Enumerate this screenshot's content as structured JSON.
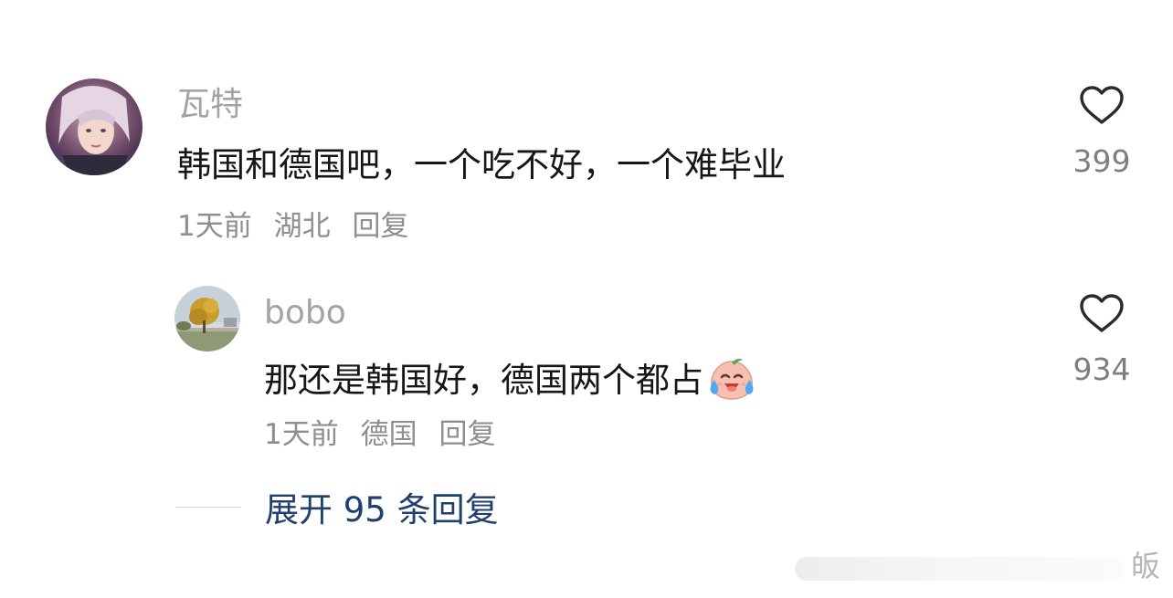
{
  "comments": [
    {
      "username": "瓦特",
      "content": "韩国和德国吧，一个吃不好，一个难毕业",
      "time": "1天前",
      "location": "湖北",
      "reply_label": "回复",
      "like_count": "399"
    },
    {
      "username": "bobo",
      "content": "那还是韩国好，德国两个都占",
      "emoji": "crying-laughing-peach-emoji",
      "time": "1天前",
      "location": "德国",
      "reply_label": "回复",
      "like_count": "934"
    }
  ],
  "expand_replies": {
    "label": "展开 95 条回复"
  },
  "watermark": {
    "text": "皈"
  },
  "colors": {
    "username": "#a3a3a3",
    "content": "#161616",
    "meta": "#8e8e8e",
    "expand_link": "#1f3f6d",
    "heart_outline": "#2a2a2a"
  }
}
